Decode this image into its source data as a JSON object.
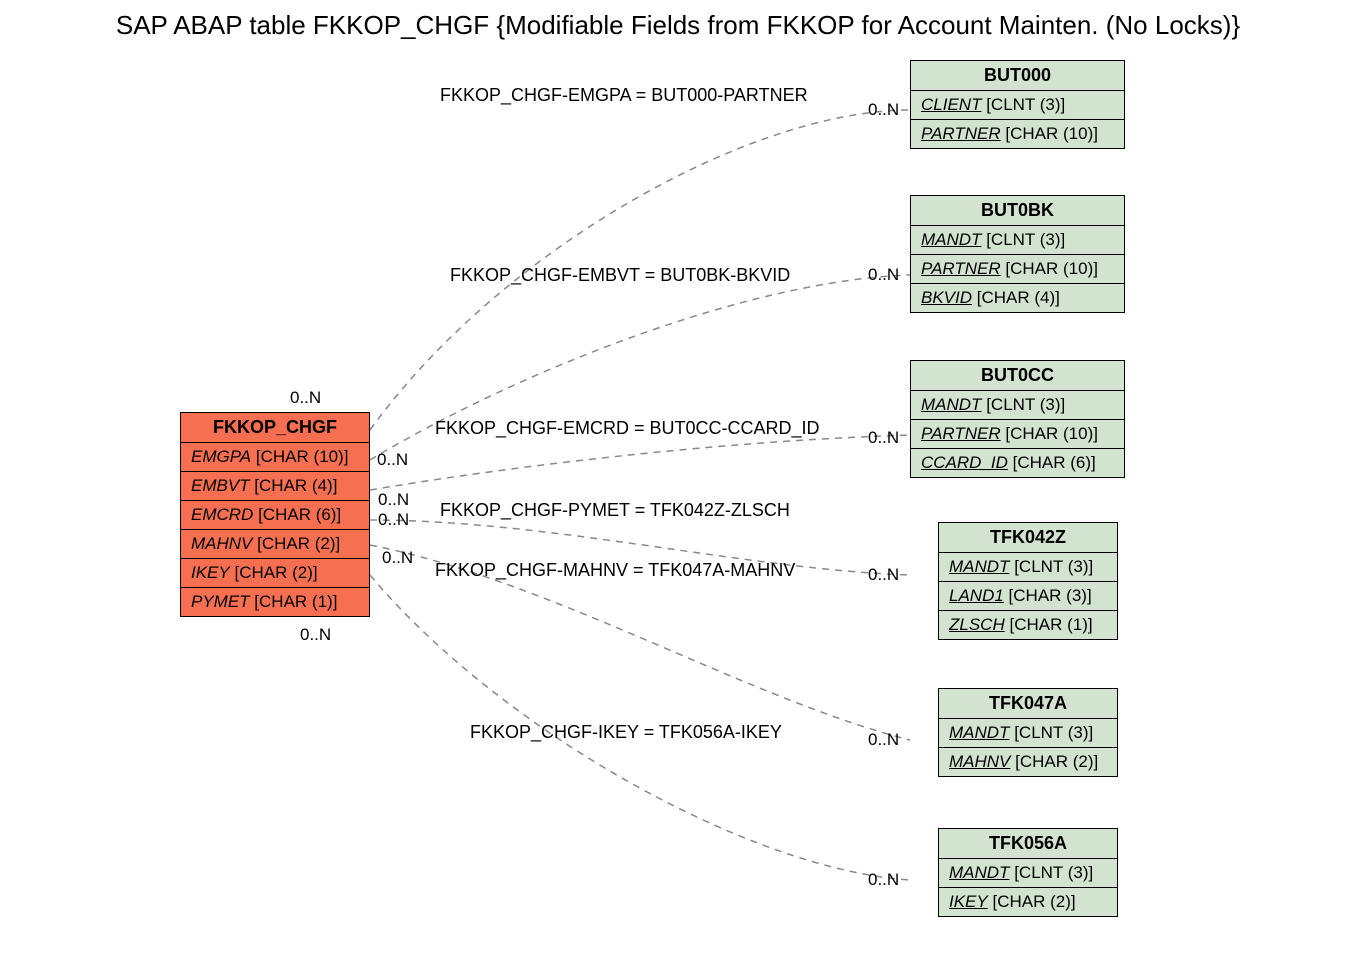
{
  "title": "SAP ABAP table FKKOP_CHGF {Modifiable Fields from FKKOP for Account Mainten. (No Locks)}",
  "main": {
    "name": "FKKOP_CHGF",
    "fields": [
      {
        "name": "EMGPA",
        "type": "[CHAR (10)]"
      },
      {
        "name": "EMBVT",
        "type": "[CHAR (4)]"
      },
      {
        "name": "EMCRD",
        "type": "[CHAR (6)]"
      },
      {
        "name": "MAHNV",
        "type": "[CHAR (2)]"
      },
      {
        "name": "IKEY",
        "type": "[CHAR (2)]"
      },
      {
        "name": "PYMET",
        "type": "[CHAR (1)]"
      }
    ]
  },
  "targets": [
    {
      "name": "BUT000",
      "fields": [
        {
          "name": "CLIENT",
          "type": "[CLNT (3)]",
          "ul": true
        },
        {
          "name": "PARTNER",
          "type": "[CHAR (10)]",
          "ul": true
        }
      ]
    },
    {
      "name": "BUT0BK",
      "fields": [
        {
          "name": "MANDT",
          "type": "[CLNT (3)]",
          "ul": true
        },
        {
          "name": "PARTNER",
          "type": "[CHAR (10)]",
          "ul": true
        },
        {
          "name": "BKVID",
          "type": "[CHAR (4)]",
          "ul": true
        }
      ]
    },
    {
      "name": "BUT0CC",
      "fields": [
        {
          "name": "MANDT",
          "type": "[CLNT (3)]",
          "ul": true
        },
        {
          "name": "PARTNER",
          "type": "[CHAR (10)]",
          "ul": true
        },
        {
          "name": "CCARD_ID",
          "type": "[CHAR (6)]",
          "ul": true
        }
      ]
    },
    {
      "name": "TFK042Z",
      "fields": [
        {
          "name": "MANDT",
          "type": "[CLNT (3)]",
          "ul": true
        },
        {
          "name": "LAND1",
          "type": "[CHAR (3)]",
          "ul": true
        },
        {
          "name": "ZLSCH",
          "type": "[CHAR (1)]",
          "ul": true
        }
      ]
    },
    {
      "name": "TFK047A",
      "fields": [
        {
          "name": "MANDT",
          "type": "[CLNT (3)]",
          "ul": true
        },
        {
          "name": "MAHNV",
          "type": "[CHAR (2)]",
          "ul": true
        }
      ]
    },
    {
      "name": "TFK056A",
      "fields": [
        {
          "name": "MANDT",
          "type": "[CLNT (3)]",
          "ul": true
        },
        {
          "name": "IKEY",
          "type": "[CHAR (2)]",
          "ul": true
        }
      ]
    }
  ],
  "relations": [
    {
      "label": "FKKOP_CHGF-EMGPA = BUT000-PARTNER"
    },
    {
      "label": "FKKOP_CHGF-EMBVT = BUT0BK-BKVID"
    },
    {
      "label": "FKKOP_CHGF-EMCRD = BUT0CC-CCARD_ID"
    },
    {
      "label": "FKKOP_CHGF-PYMET = TFK042Z-ZLSCH"
    },
    {
      "label": "FKKOP_CHGF-MAHNV = TFK047A-MAHNV"
    },
    {
      "label": "FKKOP_CHGF-IKEY = TFK056A-IKEY"
    }
  ],
  "card": "0..N"
}
